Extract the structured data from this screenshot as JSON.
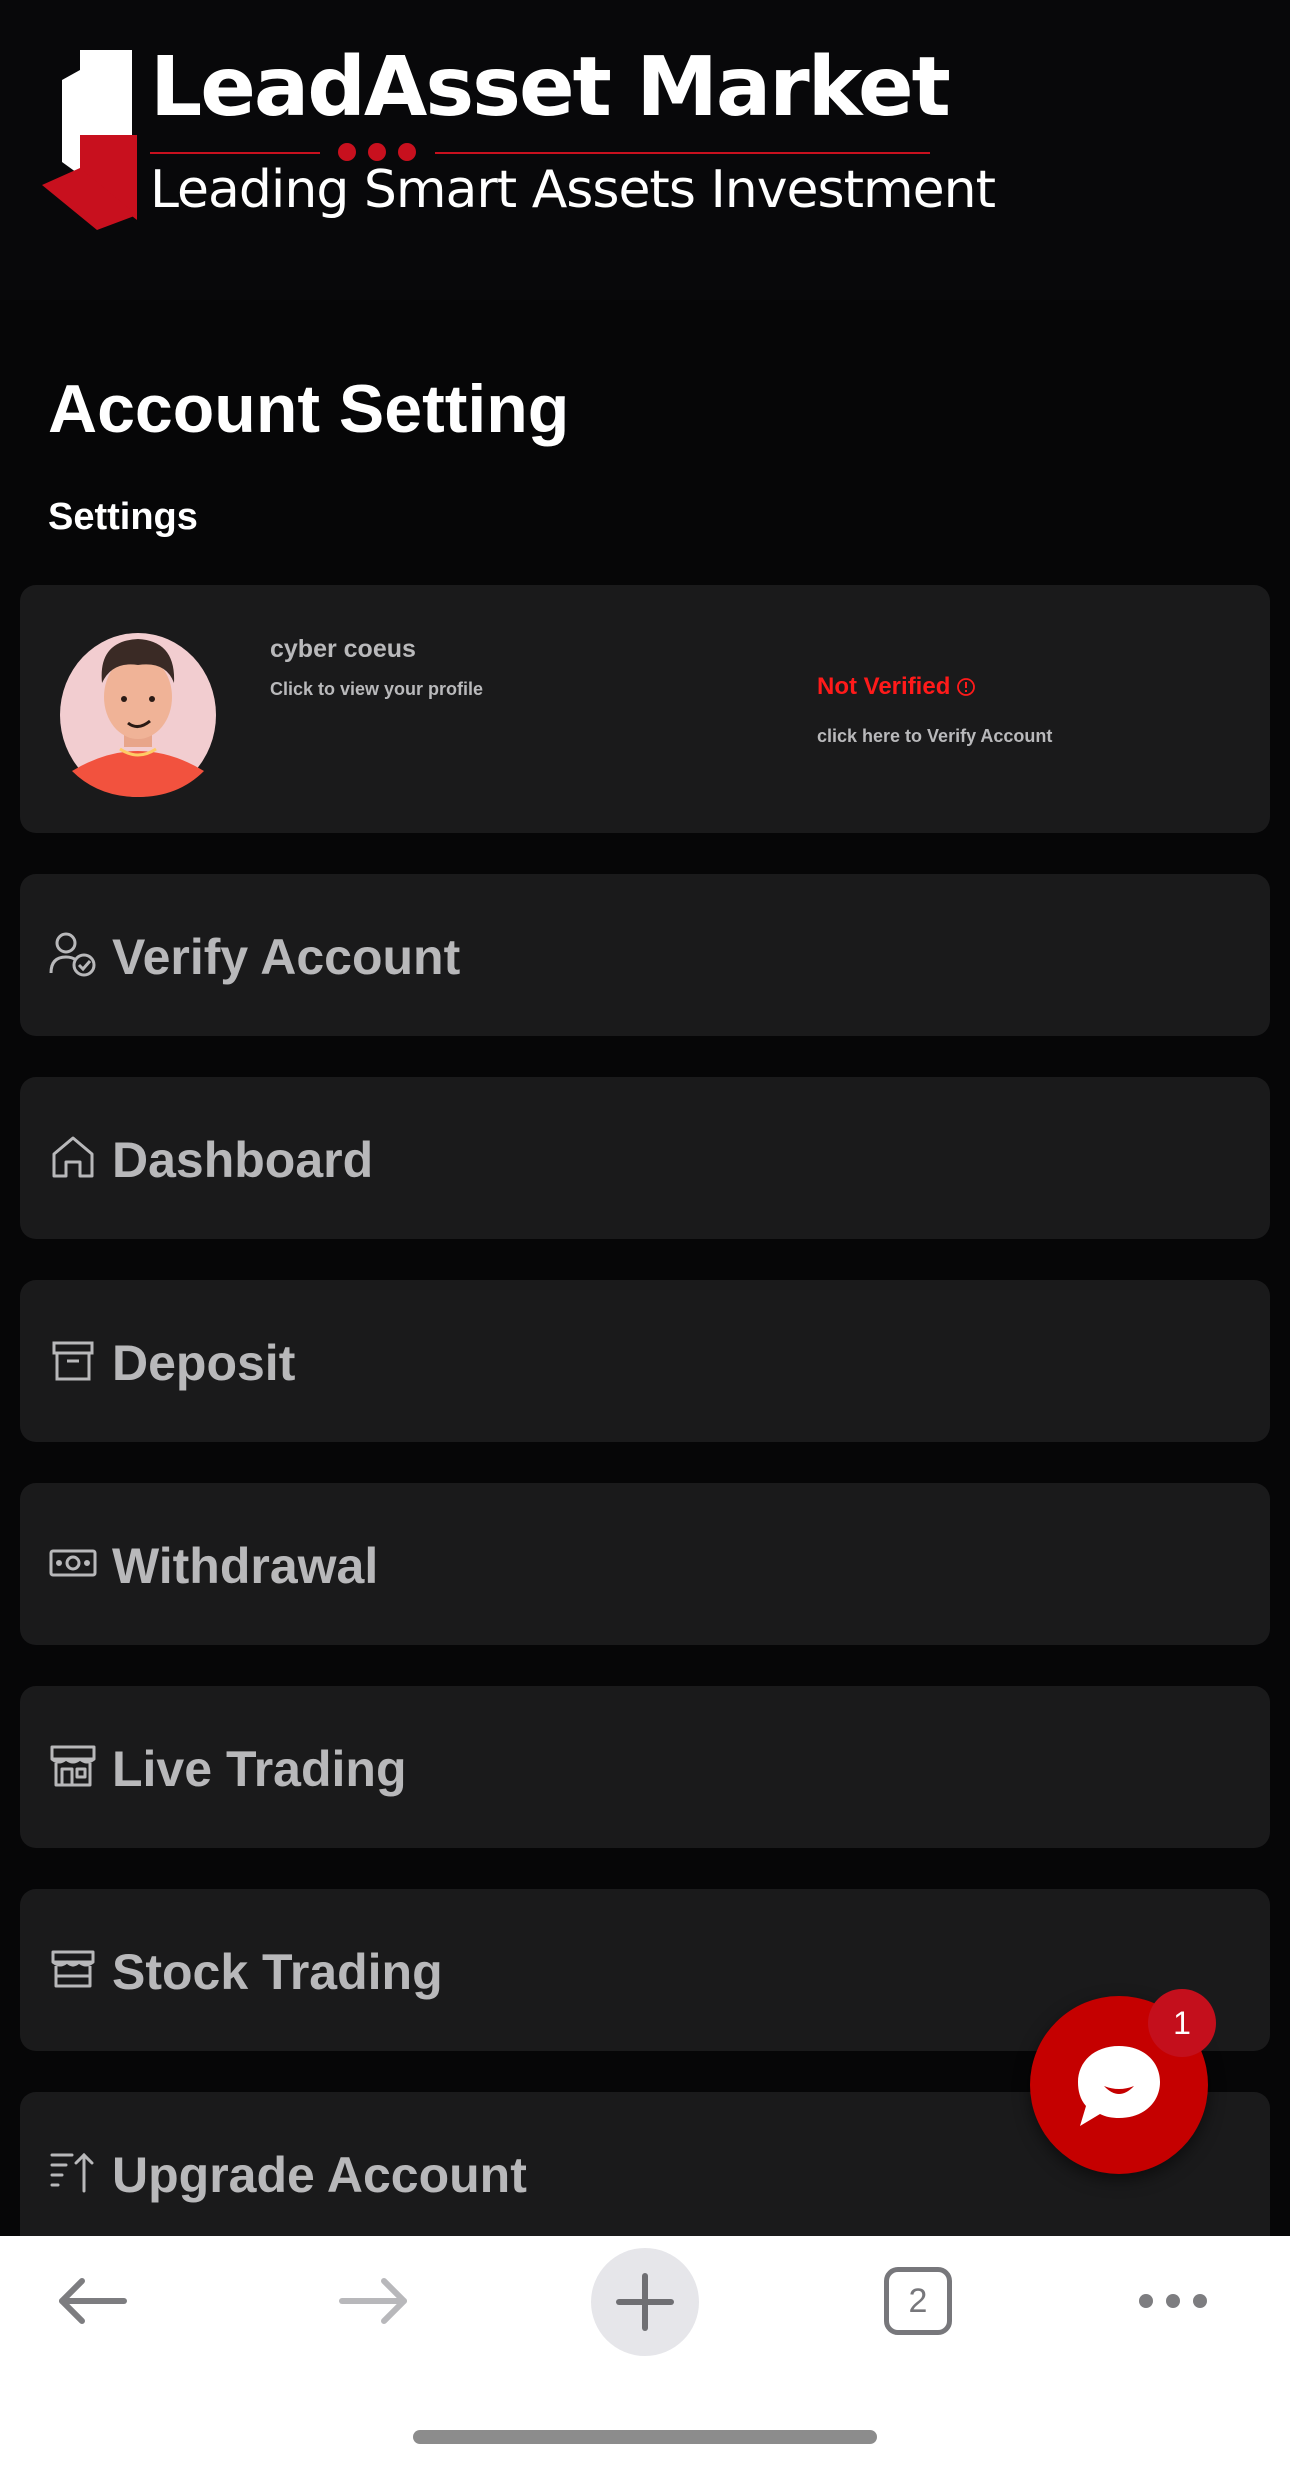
{
  "brand": {
    "title": "LeadAsset Market",
    "tagline": "Leading Smart Assets Investment",
    "accent_color": "#c8101e"
  },
  "page": {
    "title": "Account Setting",
    "section_label": "Settings"
  },
  "profile": {
    "name": "cyber coeus",
    "subtitle": "Click to view your profile",
    "status": "Not Verified",
    "status_color": "#ff1a1a",
    "verify_link": "click here to Verify Account"
  },
  "menu": {
    "items": [
      {
        "label": "Verify Account",
        "icon": "user-check-icon"
      },
      {
        "label": "Dashboard",
        "icon": "home-icon"
      },
      {
        "label": "Deposit",
        "icon": "archive-icon"
      },
      {
        "label": "Withdrawal",
        "icon": "cash-icon"
      },
      {
        "label": "Live Trading",
        "icon": "store-icon"
      },
      {
        "label": "Stock Trading",
        "icon": "store-icon"
      },
      {
        "label": "Upgrade Account",
        "icon": "sort-ascending-icon"
      }
    ]
  },
  "chat": {
    "badge_count": "1",
    "icon": "chat-bubble-icon"
  },
  "browser": {
    "tab_count": "2",
    "icons": [
      "back-arrow-icon",
      "forward-arrow-icon",
      "plus-icon",
      "tabs-icon",
      "more-icon"
    ]
  }
}
